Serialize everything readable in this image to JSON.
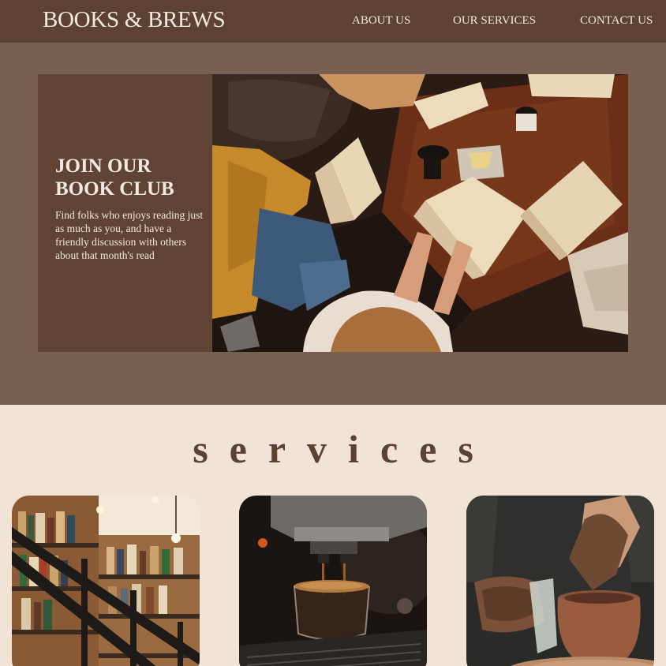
{
  "header": {
    "logo": "BOOKS & BREWS",
    "nav": [
      {
        "label": "ABOUT US"
      },
      {
        "label": "OUR SERVICES"
      },
      {
        "label": "CONTACT US"
      }
    ]
  },
  "hero": {
    "title": "JOIN OUR BOOK CLUB",
    "description": "Find folks who enjoys reading just as much as you, and have a friendly discussion with others about that month's read"
  },
  "services": {
    "heading": "services"
  },
  "colors": {
    "header_bg": "#5d4132",
    "hero_bg": "#775f52",
    "hero_box": "#5f4334",
    "page_bg": "#f1e4d6",
    "heading_text": "#5d4132"
  }
}
